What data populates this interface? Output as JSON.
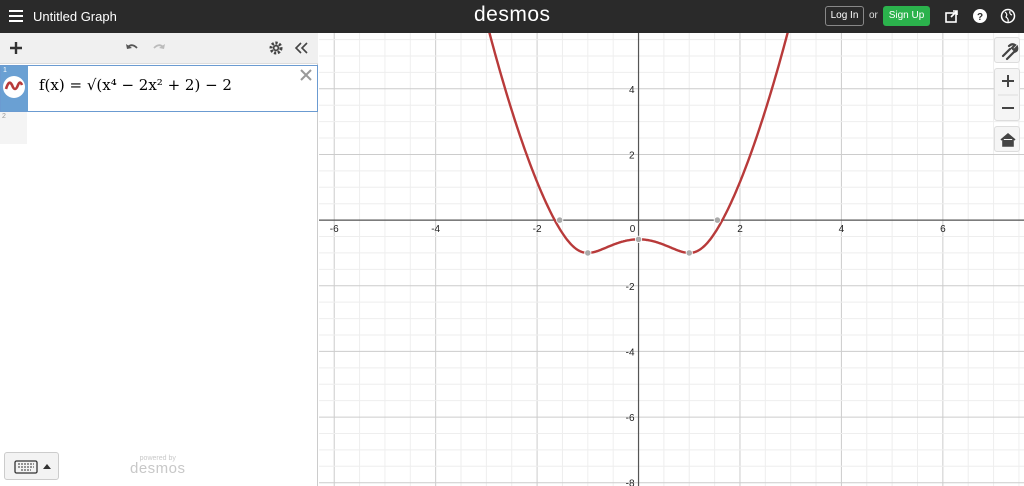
{
  "header": {
    "title": "Untitled Graph",
    "brand": "desmos",
    "login_label": "Log In",
    "or_text": "or",
    "signup_label": "Sign Up",
    "colors": {
      "bar": "#2a2a2a",
      "signup": "#2bb24c"
    }
  },
  "expressions": [
    {
      "index": "1",
      "latex_text": "f(x) = √(x⁴ − 2x² + 2) − 2",
      "color": "#b83a3a"
    },
    {
      "index": "2",
      "latex_text": ""
    }
  ],
  "footer": {
    "powered_by": "powered by",
    "powered_brand": "desmos"
  },
  "graph": {
    "function": "sqrt(x^4 - 2x^2 + 2) - 2",
    "curve_color": "#b83a3a",
    "x_ticks": [
      "-6",
      "-4",
      "-2",
      "0",
      "2",
      "4",
      "6"
    ],
    "y_ticks": [
      "4",
      "2",
      "-2",
      "-4",
      "-6",
      "-8"
    ],
    "xlim": [
      -6.3,
      7.6
    ],
    "ylim": [
      -8.1,
      5.7
    ],
    "points_of_interest": [
      {
        "x": -1.554,
        "y": 0
      },
      {
        "x": -1,
        "y": -1
      },
      {
        "x": 0,
        "y": -0.586
      },
      {
        "x": 1,
        "y": -1
      },
      {
        "x": 1.554,
        "y": 0
      }
    ]
  }
}
